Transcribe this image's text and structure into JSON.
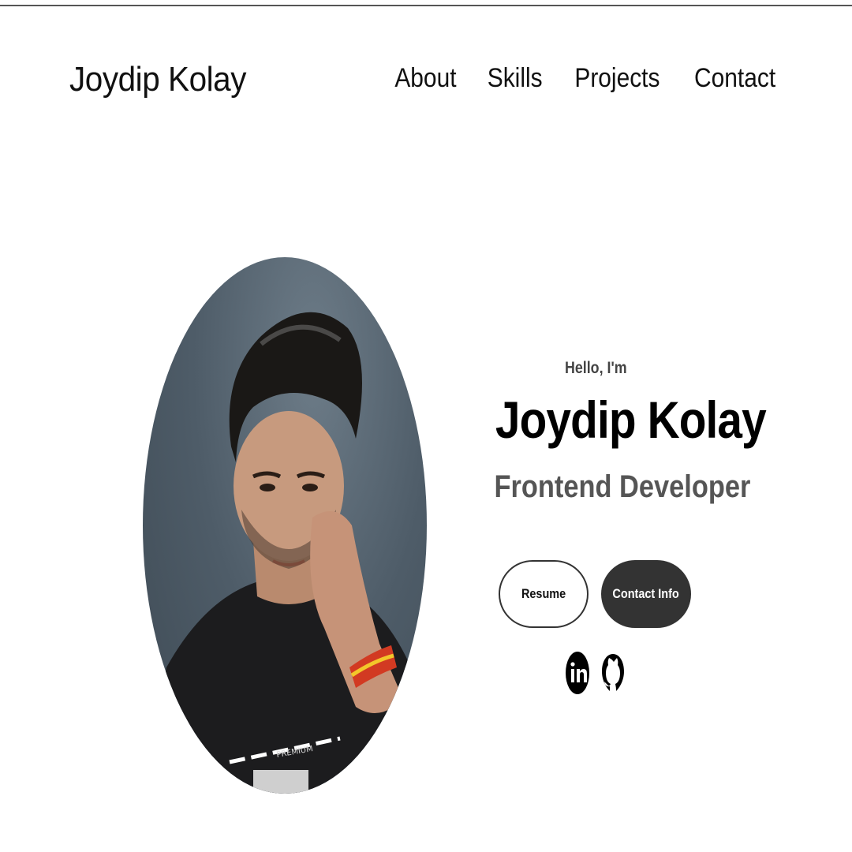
{
  "brand": {
    "name": "Joydip Kolay"
  },
  "nav": {
    "items": [
      "About",
      "Skills",
      "Projects",
      "Contact"
    ]
  },
  "hero": {
    "greeting": "Hello, I'm",
    "name": "Joydip Kolay",
    "title": "Frontend Developer"
  },
  "buttons": {
    "resume": "Resume",
    "contact": "Contact Info"
  },
  "social": {
    "icons": [
      "linkedin-icon",
      "github-icon"
    ]
  },
  "photo": {
    "shirt_text": "PREMIUM"
  },
  "colors": {
    "dark_button": "#333333",
    "text": "#000000",
    "subtitle": "#555555"
  }
}
